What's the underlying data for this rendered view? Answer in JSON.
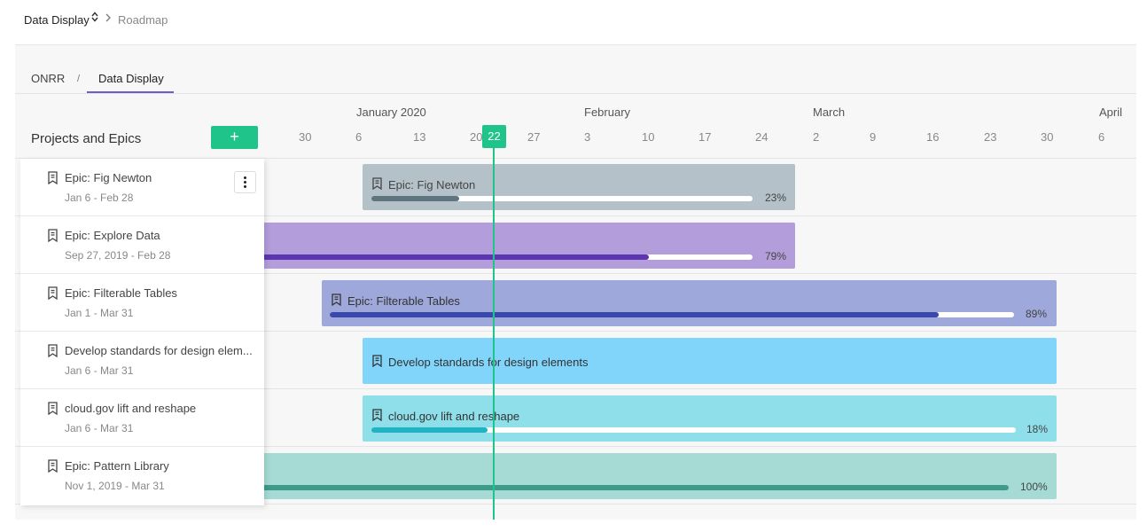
{
  "breadcrumb": {
    "project": "Data Display",
    "page": "Roadmap"
  },
  "tabs": {
    "parent": "ONRR",
    "current": "Data Display"
  },
  "timeline": {
    "months": [
      "January 2020",
      "February",
      "March",
      "April"
    ],
    "days": [
      "30",
      "6",
      "13",
      "20",
      "27",
      "3",
      "10",
      "17",
      "24",
      "2",
      "9",
      "16",
      "23",
      "30",
      "6"
    ],
    "today": "22"
  },
  "sidebar": {
    "title": "Projects and Epics",
    "add_label": "+",
    "items": [
      {
        "name": "Epic: Fig Newton",
        "dates": "Jan 6 - Feb 28"
      },
      {
        "name": "Epic: Explore Data",
        "dates": "Sep 27, 2019 - Feb 28"
      },
      {
        "name": "Epic: Filterable Tables",
        "dates": "Jan 1 - Mar 31"
      },
      {
        "name": "Develop standards for design elem...",
        "dates": "Jan 6 - Mar 31"
      },
      {
        "name": "cloud.gov lift and reshape",
        "dates": "Jan 6 - Mar 31"
      },
      {
        "name": "Epic: Pattern Library",
        "dates": "Nov 1, 2019 - Mar 31"
      }
    ]
  },
  "bars": [
    {
      "label": "Epic: Fig Newton",
      "progress": "23%",
      "progress_value": 0.23,
      "color": "#b5c1c8",
      "fill": "#5e7580"
    },
    {
      "label": "",
      "progress": "79%",
      "progress_value": 0.79,
      "color": "#b39ddb",
      "fill": "#5e35b1"
    },
    {
      "label": "Epic: Filterable Tables",
      "progress": "89%",
      "progress_value": 0.89,
      "color": "#9fa8da",
      "fill": "#3949ab"
    },
    {
      "label": "Develop standards for design elements",
      "progress": "",
      "progress_value": null,
      "color": "#81d4fa",
      "fill": "#0288d1"
    },
    {
      "label": "cloud.gov lift and reshape",
      "progress": "18%",
      "progress_value": 0.18,
      "color": "#8fdfea",
      "fill": "#1fb3c4"
    },
    {
      "label": "",
      "progress": "100%",
      "progress_value": 1.0,
      "color": "#a5dbd4",
      "fill": "#3d9b8c"
    }
  ],
  "icons": {
    "epic": "bookmark-list-icon",
    "more": "more-vertical-icon",
    "caret": "sort-caret-icon",
    "chevron": "chevron-right-icon"
  },
  "colors": {
    "accent": "#1fc48b",
    "tab_underline": "#6b5fc7"
  }
}
